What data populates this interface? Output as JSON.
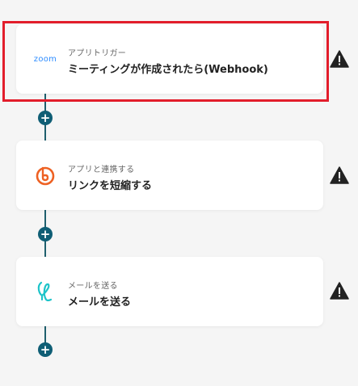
{
  "colors": {
    "accent_teal": "#0f5e75",
    "highlight_red": "#e21d2b",
    "zoom_blue": "#2d8cff",
    "bitly_orange": "#ee6123",
    "mail_teal": "#1ec4c9"
  },
  "steps": [
    {
      "icon": "zoom-icon",
      "logo_text": "zoom",
      "subtitle": "アプリトリガー",
      "title": "ミーティングが作成されたら(Webhook)",
      "highlighted": true
    },
    {
      "icon": "bitly-icon",
      "subtitle": "アプリと連携する",
      "title": "リンクを短縮する",
      "highlighted": false
    },
    {
      "icon": "mail-icon",
      "subtitle": "メールを送る",
      "title": "メールを送る",
      "highlighted": false
    }
  ],
  "add_button_icon": "plus-icon",
  "status_icon": "warning-icon",
  "add_button_glyph": "+"
}
